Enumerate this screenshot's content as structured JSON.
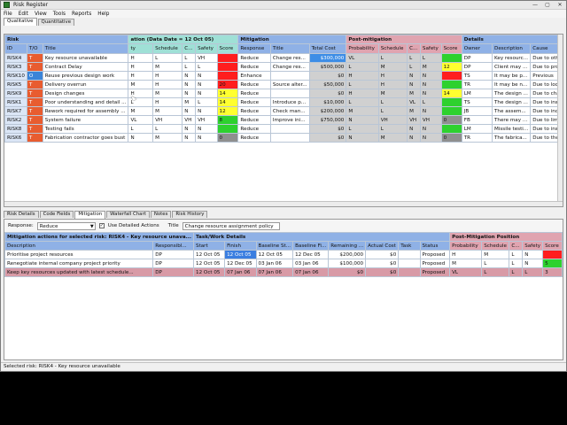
{
  "window": {
    "title": "Risk Register",
    "controls": [
      "—",
      "▢",
      "✕"
    ]
  },
  "menu": [
    "File",
    "Edit",
    "View",
    "Tools",
    "Reports",
    "Help"
  ],
  "top_tabs": [
    "Qualitative",
    "Quantitative"
  ],
  "grid": {
    "groups": {
      "risk": "Risk",
      "evaluation": "ation (Data Date = 12 Oct 05)",
      "mitigation": "Mitigation",
      "post": "Post-mitigation",
      "details": "Details"
    },
    "columns": [
      "ID",
      "T/O",
      "Title",
      "ty",
      "Schedule",
      "C...",
      "Safety",
      "Score",
      "Response",
      "Title",
      "Total Cost",
      "Probability",
      "Schedule",
      "C...",
      "Safety",
      "Score",
      "Owner",
      "Description",
      "Cause"
    ],
    "rows": [
      {
        "id": "RISK4",
        "to": "T",
        "title": "Key resource unavailable",
        "p": "H",
        "s": "L",
        "c": "L",
        "sf": "VH",
        "score": "",
        "resp": "Reduce",
        "mtitle": "Change res...",
        "cost": "$300,000",
        "pp": "VL",
        "ps": "L",
        "pc": "L",
        "psf": "L",
        "pscore": "",
        "owner": "DP",
        "desc": "Key resourc...",
        "cause": "Due to oth"
      },
      {
        "id": "RISK3",
        "to": "T",
        "title": "Contract Delay",
        "p": "H",
        "s": "M",
        "c": "L",
        "sf": "L",
        "score": "",
        "resp": "Reduce",
        "mtitle": "Change res...",
        "cost": "$500,000",
        "pp": "L",
        "ps": "M",
        "pc": "L",
        "psf": "M",
        "pscore": "12",
        "owner": "DP",
        "desc": "Client may ...",
        "cause": "Due to pro"
      },
      {
        "id": "RISK10",
        "to": "O",
        "title": "Reuse previous design work",
        "p": "H",
        "s": "H",
        "c": "N",
        "sf": "N",
        "score": "",
        "resp": "Enhance",
        "mtitle": "",
        "cost": "$0",
        "pp": "H",
        "ps": "H",
        "pc": "N",
        "psf": "N",
        "pscore": "",
        "owner": "TS",
        "desc": "It may be p...",
        "cause": "Previous"
      },
      {
        "id": "RISK5",
        "to": "T",
        "title": "Delivery overrun",
        "p": "M",
        "s": "H",
        "c": "N",
        "sf": "N",
        "score": "20",
        "resp": "Reduce",
        "mtitle": "Source alter...",
        "cost": "$50,000",
        "pp": "L",
        "ps": "H",
        "pc": "N",
        "psf": "N",
        "pscore": "",
        "owner": "TR",
        "desc": "It may be n...",
        "cause": "Due to loc"
      },
      {
        "id": "RISK9",
        "to": "T",
        "title": "Design changes",
        "p": "H",
        "s": "M",
        "c": "N",
        "sf": "N",
        "score": "14",
        "resp": "Reduce",
        "mtitle": "",
        "cost": "$0",
        "pp": "H",
        "ps": "M",
        "pc": "M",
        "psf": "N",
        "pscore": "14",
        "owner": "LM",
        "desc": "The design ...",
        "cause": "Due to cha"
      },
      {
        "id": "RISK1",
        "to": "T",
        "title": "Poor understanding and detail ...",
        "p": "L",
        "s": "H",
        "c": "M",
        "sf": "L",
        "score": "14",
        "resp": "Reduce",
        "mtitle": "Introduce p...",
        "cost": "$10,000",
        "pp": "L",
        "ps": "L",
        "pc": "VL",
        "psf": "L",
        "pscore": "",
        "owner": "TS",
        "desc": "The design ...",
        "cause": "Due to inst"
      },
      {
        "id": "RISK7",
        "to": "T",
        "title": "Rework required for assembly ...",
        "p": "M",
        "s": "M",
        "c": "N",
        "sf": "N",
        "score": "12",
        "resp": "Reduce",
        "mtitle": "Check man...",
        "cost": "$200,000",
        "pp": "M",
        "ps": "L",
        "pc": "M",
        "psf": "N",
        "pscore": "",
        "owner": "JB",
        "desc": "The assem...",
        "cause": "Due to inc"
      },
      {
        "id": "RISK2",
        "to": "T",
        "title": "System failure",
        "p": "VL",
        "s": "VH",
        "c": "VH",
        "sf": "VH",
        "score": "8",
        "resp": "Reduce",
        "mtitle": "Improve ini...",
        "cost": "$750,000",
        "pp": "N",
        "ps": "VH",
        "pc": "VH",
        "psf": "VH",
        "pscore": "0",
        "owner": "FB",
        "desc": "There may ...",
        "cause": "Due to lim"
      },
      {
        "id": "RISK8",
        "to": "T",
        "title": "Testing fails",
        "p": "L",
        "s": "L",
        "c": "N",
        "sf": "N",
        "score": "",
        "resp": "Reduce",
        "mtitle": "",
        "cost": "$0",
        "pp": "L",
        "ps": "L",
        "pc": "N",
        "psf": "N",
        "pscore": "",
        "owner": "LM",
        "desc": "Missile testi...",
        "cause": "Due to ins"
      },
      {
        "id": "RISK6",
        "to": "T",
        "title": "Fabrication contractor goes bust",
        "p": "N",
        "s": "M",
        "c": "N",
        "sf": "N",
        "score": "0",
        "resp": "Reduce",
        "mtitle": "",
        "cost": "$0",
        "pp": "N",
        "ps": "M",
        "pc": "N",
        "psf": "N",
        "pscore": "0",
        "owner": "TR",
        "desc": "The fabrica...",
        "cause": "Due to the"
      }
    ]
  },
  "lower_tabs": [
    "Risk Details",
    "Code Fields",
    "Mitigation",
    "Waterfall Chart",
    "Notes",
    "Risk History"
  ],
  "mitigation_panel": {
    "response_label": "Response:",
    "response_value": "Reduce",
    "use_detailed_label": "Use Detailed Actions",
    "title_label": "Title",
    "title_value": "Change resource assignment policy",
    "group_actions": "Mitigation actions for selected risk: RISK4 - Key resource unava...",
    "group_task": "Task/Work Details",
    "group_post": "Post-Mitigation Position",
    "columns": [
      "Description",
      "Responsibl...",
      "Start",
      "Finish",
      "Baseline St...",
      "Baseline Fi...",
      "Remaining ...",
      "Actual Cost",
      "Task",
      "Status",
      "Probability",
      "Schedule",
      "C...",
      "Safety",
      "Score"
    ],
    "rows": [
      {
        "desc": "Prioritise project resources",
        "resp": "DP",
        "start": "12 Oct 05",
        "finish": "12 Oct 05",
        "bstart": "12 Oct 05",
        "bfinish": "12 Dec 05",
        "remaining": "$200,000",
        "actual": "$0",
        "task": "",
        "status": "Proposed",
        "prob": "H",
        "sched": "M",
        "cost": "L",
        "safety": "N",
        "score": ""
      },
      {
        "desc": "Renegotiate internal company project priority",
        "resp": "DP",
        "start": "12 Oct 05",
        "finish": "12 Dec 05",
        "bstart": "03 Jan 06",
        "bfinish": "03 Jan 06",
        "remaining": "$100,000",
        "actual": "$0",
        "task": "",
        "status": "Proposed",
        "prob": "M",
        "sched": "L",
        "cost": "L",
        "safety": "N",
        "score": "5"
      },
      {
        "desc": "Keep key resources updated with latest schedule...",
        "resp": "DP",
        "start": "12 Oct 05",
        "finish": "07 Jan 06",
        "bstart": "07 Jan 06",
        "bfinish": "07 Jan 06",
        "remaining": "$0",
        "actual": "$0",
        "task": "",
        "status": "Proposed",
        "prob": "VL",
        "sched": "L",
        "cost": "L",
        "safety": "L",
        "score": "3"
      }
    ]
  },
  "status_bar": "Selected risk: RISK4 - Key resource unavailable",
  "colors": {
    "red": "#ff1e1e",
    "yellow": "#ffff30",
    "green": "#2ed12e",
    "grey": "#8f8f8f",
    "threat": "#e85c30",
    "opportunity": "#3a84d8"
  }
}
